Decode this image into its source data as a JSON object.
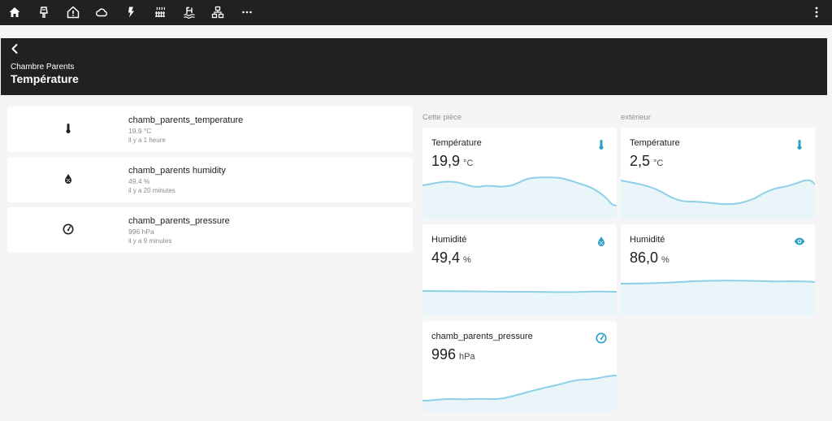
{
  "header": {
    "breadcrumb": "Chambre Parents",
    "title": "Température"
  },
  "topbar": {
    "icons": [
      "home-icon",
      "lamp-icon",
      "house-alert-icon",
      "cloud-icon",
      "flash-icon",
      "radiator-icon",
      "pool-icon",
      "network-icon",
      "more-horizontal-icon",
      "more-vertical-icon"
    ]
  },
  "entities": [
    {
      "name": "chamb_parents_temperature",
      "value": "19.9 °C",
      "time": "il y a 1 heure",
      "icon": "thermometer-icon"
    },
    {
      "name": "chamb_parents humidity",
      "value": "49.4 %",
      "time": "il y a 20 minutes",
      "icon": "water-percent-icon"
    },
    {
      "name": "chamb_parents_pressure",
      "value": "996 hPa",
      "time": "il y a 9 minutes",
      "icon": "gauge-icon"
    }
  ],
  "columns": {
    "left": "Cette pièce",
    "right": "extérieur"
  },
  "cards": {
    "room_temp": {
      "name": "Température",
      "value": "19,9",
      "unit": "°C",
      "icon": "thermometer-icon"
    },
    "out_temp": {
      "name": "Température",
      "value": "2,5",
      "unit": "°C",
      "icon": "thermometer-icon"
    },
    "room_hum": {
      "name": "Humidité",
      "value": "49,4",
      "unit": "%",
      "icon": "water-percent-icon"
    },
    "out_hum": {
      "name": "Humidité",
      "value": "86,0",
      "unit": "%",
      "icon": "eye-icon"
    },
    "room_press": {
      "name": "chamb_parents_pressure",
      "value": "996",
      "unit": "hPa",
      "icon": "gauge-icon"
    }
  },
  "colors": {
    "accent": "#2a9fc8",
    "graph_line": "#8ed0e6",
    "graph_fill": "#eaf5f9",
    "bar": "#212121"
  }
}
